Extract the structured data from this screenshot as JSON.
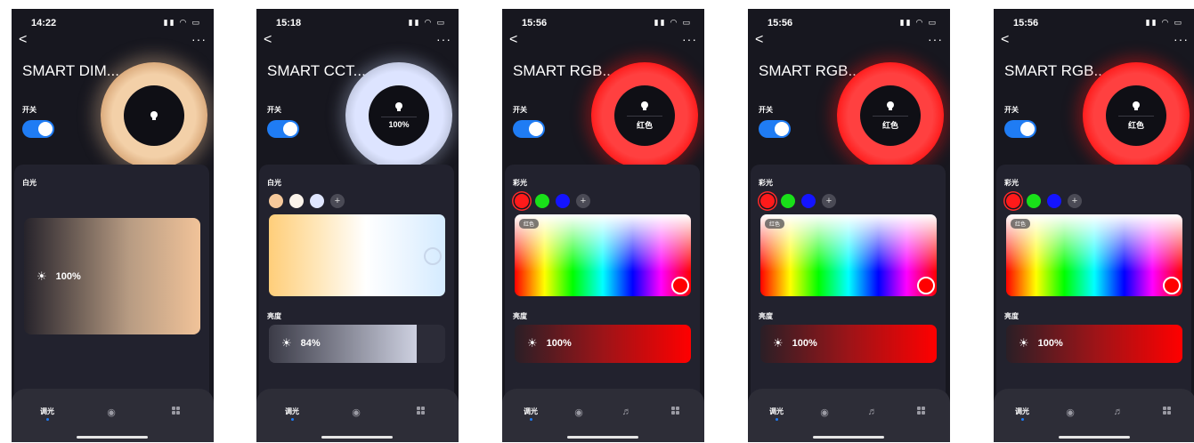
{
  "phones": [
    {
      "time": "14:22",
      "title": "SMART DIM...",
      "ring_value": "",
      "switch_label": "开关",
      "section_label": "白光",
      "slider_value": "100%",
      "tabs": [
        "调光"
      ]
    },
    {
      "time": "15:18",
      "title": "SMART CCT...",
      "ring_value": "100%",
      "switch_label": "开关",
      "section_label": "白光",
      "brightness_label": "亮度",
      "brightness_value": "84%",
      "brightness_level": 0.84,
      "tabs": [
        "调光"
      ]
    },
    {
      "time": "15:56",
      "title": "SMART RGB...",
      "ring_value": "红色",
      "switch_label": "开关",
      "section_label": "彩光",
      "picker_tag": "红色",
      "brightness_label": "亮度",
      "brightness_value": "100%",
      "tabs": [
        "调光"
      ]
    },
    {
      "time": "15:56",
      "title": "SMART RGB...",
      "ring_value": "红色",
      "switch_label": "开关",
      "section_label": "彩光",
      "picker_tag": "红色",
      "brightness_label": "亮度",
      "brightness_value": "100%",
      "tabs": [
        "调光"
      ]
    },
    {
      "time": "15:56",
      "title": "SMART RGB...",
      "ring_value": "红色",
      "switch_label": "开关",
      "section_label": "彩光",
      "picker_tag": "红色",
      "brightness_label": "亮度",
      "brightness_value": "100%",
      "tabs": [
        "调光"
      ]
    }
  ],
  "icons": {
    "back": "<",
    "more": "···",
    "add": "+",
    "sun": "☀",
    "palette": "palette-icon",
    "music": "music-icon",
    "grid": "grid-icon"
  },
  "colors": {
    "accent": "#1f7cf4",
    "bg": "#17171f",
    "card": "#22222e",
    "red": "#ff1a1a",
    "warm": "#f1c399",
    "cool": "#dce5ff"
  }
}
